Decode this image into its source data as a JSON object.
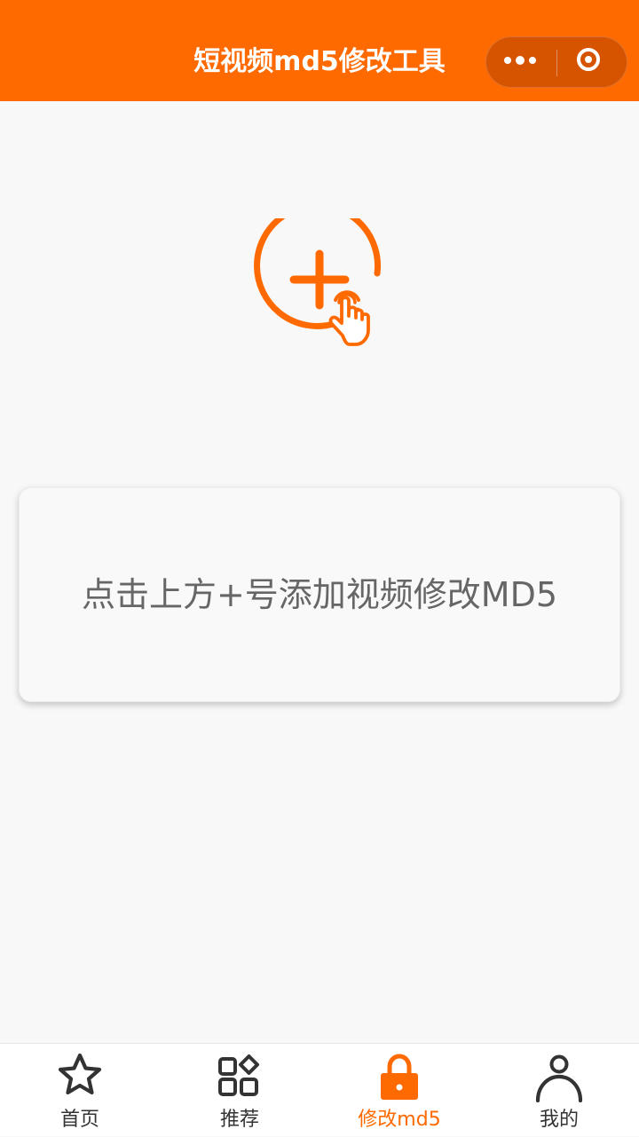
{
  "header": {
    "title": "短视频md5修改工具",
    "background_color": "#ff6a00",
    "capsule": {
      "more_icon": "more-dots-icon",
      "close_icon": "target-circle-icon"
    }
  },
  "main": {
    "add_icon": "plus-circle-tap-icon",
    "accent_color": "#ff6a00",
    "hint": "点击上方+号添加视频修改MD5"
  },
  "tabbar": {
    "active_color": "#ff6a00",
    "inactive_color": "#333333",
    "items": [
      {
        "label": "首页",
        "icon": "star-icon",
        "active": false
      },
      {
        "label": "推荐",
        "icon": "grid-apps-icon",
        "active": false
      },
      {
        "label": "修改md5",
        "icon": "lock-icon",
        "active": true
      },
      {
        "label": "我的",
        "icon": "user-icon",
        "active": false
      }
    ]
  }
}
